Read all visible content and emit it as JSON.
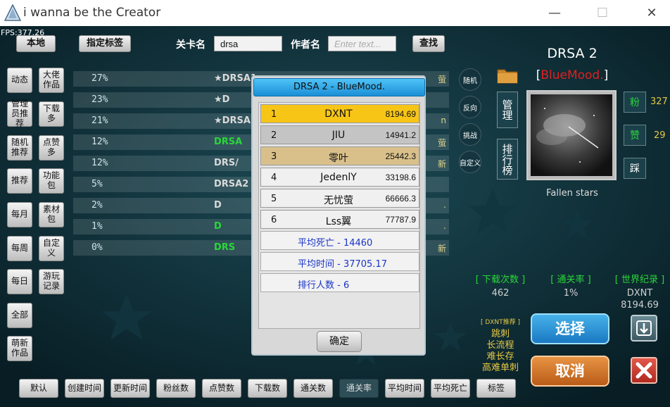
{
  "window": {
    "title": "i wanna be the Creator",
    "minimize": "—",
    "maximize": "☐",
    "close": "✕"
  },
  "fps": "FPS:377.26",
  "search": {
    "local_btn": "本地",
    "tag_btn": "指定标签",
    "level_label": "关卡名",
    "level_value": "drsa",
    "author_label": "作者名",
    "author_placeholder": "Enter text...",
    "search_btn": "查找"
  },
  "categories": [
    [
      "动态",
      "大佬作品"
    ],
    [
      "管理员推荐",
      "下载多"
    ],
    [
      "随机推荐",
      "点赞多"
    ],
    [
      "推荐",
      "功能包"
    ],
    [
      "每月",
      "素材包"
    ],
    [
      "每周",
      "自定义"
    ],
    [
      "每日",
      "游玩记录"
    ],
    [
      "全部"
    ],
    [
      "萌新作品"
    ]
  ],
  "levels": [
    {
      "pct": "27%",
      "name": "★DRSA1",
      "tail": "萤",
      "green": false
    },
    {
      "pct": "23%",
      "name": "★D",
      "tail": "",
      "green": false
    },
    {
      "pct": "21%",
      "name": "★DRSA2",
      "tail": "n",
      "green": false
    },
    {
      "pct": "12%",
      "name": "DRSA",
      "tail": "萤",
      "green": true
    },
    {
      "pct": "12%",
      "name": "DRS/",
      "tail": "新",
      "green": false
    },
    {
      "pct": "5%",
      "name": "DRSA2",
      "tail": "",
      "green": false
    },
    {
      "pct": "2%",
      "name": "D",
      "tail": ".",
      "green": false
    },
    {
      "pct": "1%",
      "name": "D",
      "tail": ".",
      "green": true
    },
    {
      "pct": "0%",
      "name": "DRS",
      "tail": "新",
      "green": true
    }
  ],
  "side_icons": [
    "随机",
    "反向",
    "挑战",
    "自定义"
  ],
  "manage_btn": "管理",
  "rank_btn": "排行榜",
  "detail": {
    "title": "DRSA 2",
    "author": "BlueMood.",
    "caption": "Fallen stars",
    "fans_label": "粉",
    "fans": "327",
    "likes_label": "赞",
    "likes": "29",
    "dislike_label": "踩",
    "downloads_h": "[ 下载次数 ]",
    "downloads": "462",
    "clear_h": "[ 通关率 ]",
    "clear": "1%",
    "record_h": "[ 世界纪录 ]",
    "record_holder": "DXNT",
    "record_time": "8194.69",
    "rec_label": "[ DXNT推荐 ]",
    "tags": [
      "跳刺",
      "长流程",
      "难长存",
      "高难单刺"
    ],
    "select_btn": "选择",
    "cancel_btn": "取消"
  },
  "sort_buttons": [
    "默认",
    "创建时间",
    "更新时间",
    "粉丝数",
    "点赞数",
    "下载数",
    "通关数",
    "通关率",
    "平均时间",
    "平均死亡",
    "标签"
  ],
  "modal": {
    "title": "DRSA 2 - BlueMood.",
    "ranks": [
      {
        "no": "1",
        "name": "DXNT",
        "score": "8194.69"
      },
      {
        "no": "2",
        "name": "JIU",
        "score": "14941.2"
      },
      {
        "no": "3",
        "name": "零叶",
        "score": "25442.3"
      },
      {
        "no": "4",
        "name": "JedenlY",
        "score": "33198.6"
      },
      {
        "no": "5",
        "name": "无忧萤",
        "score": "66666.3"
      },
      {
        "no": "6",
        "name": "Lss翼",
        "score": "77787.9"
      }
    ],
    "avg_death": "平均死亡 - 14460",
    "avg_time": "平均时间 - 37705.17",
    "count": "排行人数 - 6",
    "ok": "确定"
  },
  "colors": {
    "author": "#e02020",
    "accent_green": "#2ad63a",
    "gold": "#f7c516",
    "select": "#2a9ad6",
    "cancel": "#d9772a"
  }
}
